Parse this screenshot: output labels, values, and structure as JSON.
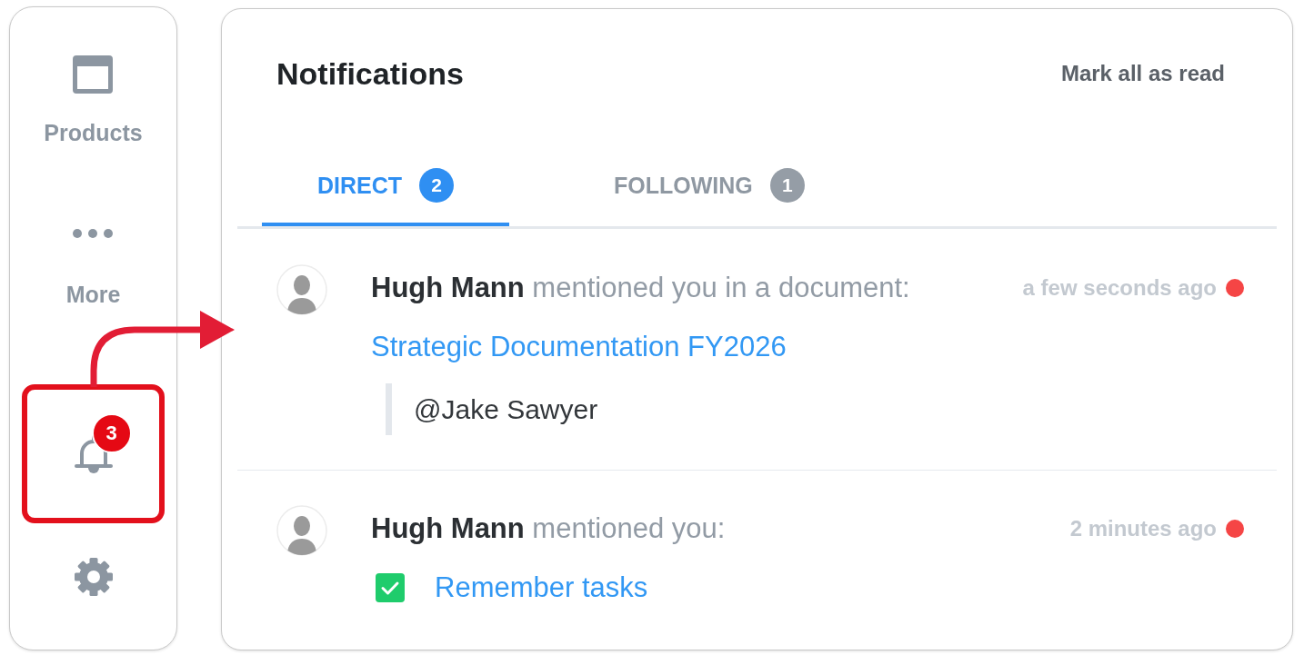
{
  "sidebar": {
    "items": [
      {
        "kind": "products",
        "label": "Products",
        "highlighted": false
      },
      {
        "kind": "more",
        "label": "More",
        "highlighted": false
      },
      {
        "kind": "notifications",
        "badge": "3",
        "highlighted": true
      },
      {
        "kind": "settings",
        "highlighted": false
      }
    ]
  },
  "header": {
    "title": "Notifications",
    "action": "Mark all as read"
  },
  "tabs": [
    {
      "label": "DIRECT",
      "count": "2",
      "selected": true
    },
    {
      "label": "FOLLOWING",
      "count": "1",
      "selected": false
    }
  ],
  "notifications": [
    {
      "kind": "document",
      "text": "**Hugh Mann** mentioned you in a document:",
      "time": "a few seconds ago",
      "unread": true,
      "link": "Strategic Documentation FY2026",
      "quote": "@Jake Sawyer"
    },
    {
      "kind": "task",
      "text": "**Hugh Mann** mentioned you:",
      "time": "2 minutes ago",
      "unread": true,
      "task": {
        "label": "Remember tasks",
        "checked": true
      }
    }
  ]
}
